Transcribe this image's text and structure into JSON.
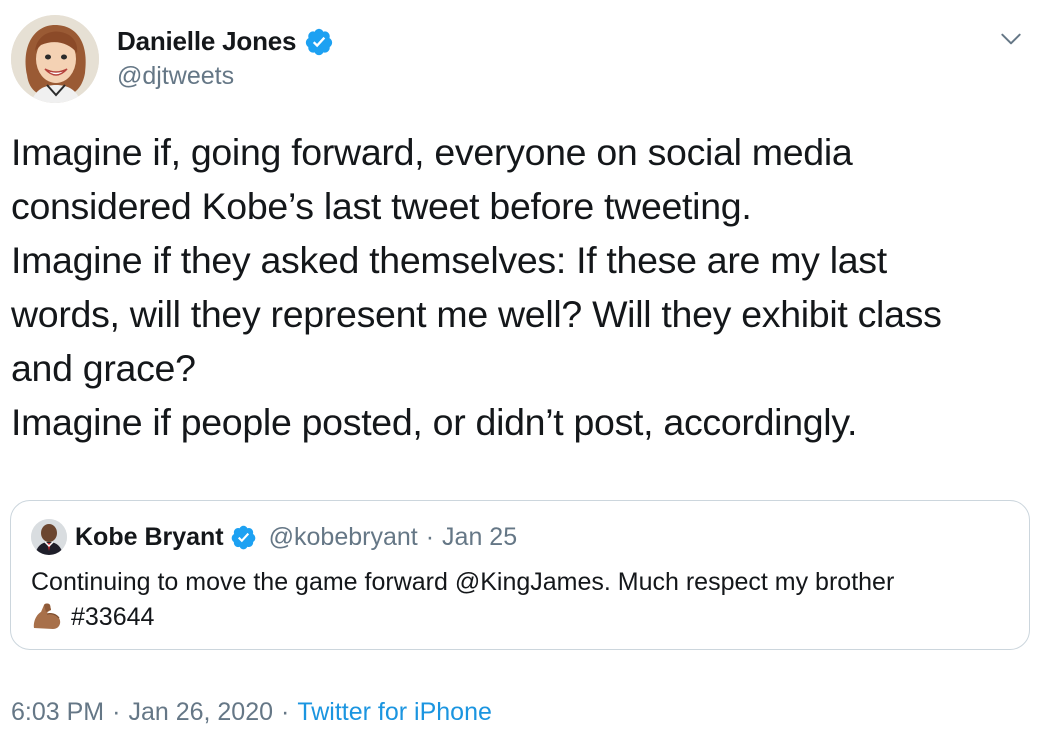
{
  "author": {
    "name": "Danielle Jones",
    "handle": "@djtweets",
    "verified_color": "#1da1f2"
  },
  "tweet": {
    "lines": [
      "Imagine if, going forward, everyone on social media",
      "considered Kobe’s last tweet before tweeting.",
      "Imagine if they asked themselves: If these are my last",
      "words, will they represent me well? Will they exhibit class",
      "and grace?",
      "Imagine if people posted, or didn’t post, accordingly."
    ]
  },
  "quoted_tweet": {
    "name": "Kobe Bryant",
    "handle": "@kobebryant",
    "separator": "·",
    "date": "Jan 25",
    "line1": "Continuing to move the game forward @KingJames. Much respect my brother",
    "emoji": "flexed-biceps-icon",
    "line2": "#33644"
  },
  "footer": {
    "time": "6:03 PM",
    "sep1": "·",
    "date": "Jan 26, 2020",
    "sep2": "·",
    "source": "Twitter for iPhone"
  },
  "colors": {
    "text": "#14171a",
    "muted": "#657786",
    "link": "#1b95e0",
    "border": "#ccd6dd"
  },
  "icons": [
    "verified-badge-icon",
    "chevron-down-icon",
    "flexed-biceps-icon"
  ]
}
